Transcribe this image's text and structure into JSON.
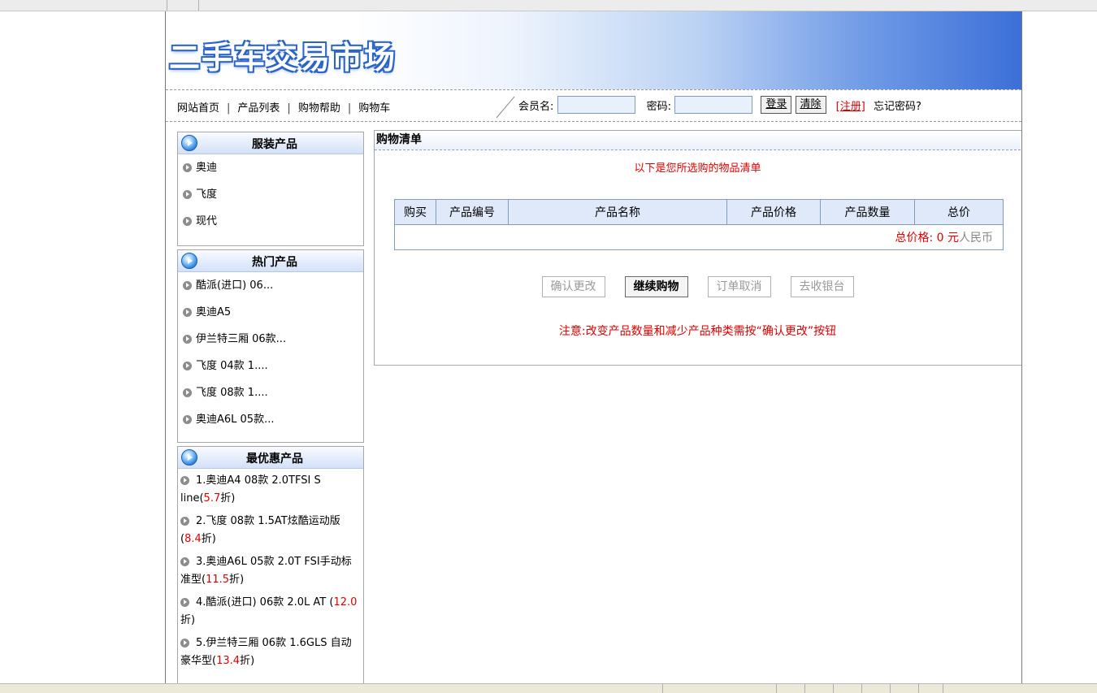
{
  "site": {
    "logo_text": "二手车交易市场"
  },
  "nav": {
    "links": [
      "网站首页",
      "产品列表",
      "购物帮助",
      "购物车"
    ],
    "separator": "|"
  },
  "login": {
    "username_label": "会员名:",
    "password_label": "密码:",
    "login_button": "登录",
    "clear_button": "清除",
    "register_link": "[注册]",
    "forgot_text": "忘记密码?"
  },
  "sidebar": {
    "apparel": {
      "title": "服装产品",
      "items": [
        "奥迪",
        "飞度",
        "现代"
      ]
    },
    "hot": {
      "title": "热门产品",
      "items": [
        "酷派(进口) 06...",
        "奥迪A5",
        "伊兰特三厢 06款...",
        "飞度 04款 1....",
        "飞度 08款 1....",
        "奥迪A6L 05款..."
      ]
    },
    "deals": {
      "title": "最优惠产品",
      "items": [
        {
          "text": "1.奥迪A4 08款 2.0TFSI S line",
          "discount": "5.7",
          "suffix": "折"
        },
        {
          "text": "2.飞度 08款 1.5AT炫酷运动版",
          "discount": "8.4",
          "suffix": "折"
        },
        {
          "text": "3.奥迪A6L 05款 2.0T FSI手动标准型",
          "discount": "11.5",
          "suffix": "折"
        },
        {
          "text": "4.酷派(进口) 06款 2.0L AT ",
          "discount": "12.0",
          "suffix": "折"
        },
        {
          "text": "5.伊兰特三厢 06款 1.6GLS 自动豪华型",
          "discount": "13.4",
          "suffix": "折"
        }
      ]
    }
  },
  "cart": {
    "title": "购物清单",
    "intro": "以下是您所选购的物品清单",
    "columns": [
      "购买",
      "产品编号",
      "产品名称",
      "产品价格",
      "产品数量",
      "总价"
    ],
    "total_label": "总价格:",
    "total_value": "0",
    "total_currency": "元",
    "total_unit": "人民币",
    "buttons": {
      "confirm": "确认更改",
      "continue": "继续购物",
      "cancel": "订单取消",
      "checkout": "去收银台"
    },
    "note": "注意:改变产品数量和减少产品种类需按“确认更改”按钮"
  }
}
